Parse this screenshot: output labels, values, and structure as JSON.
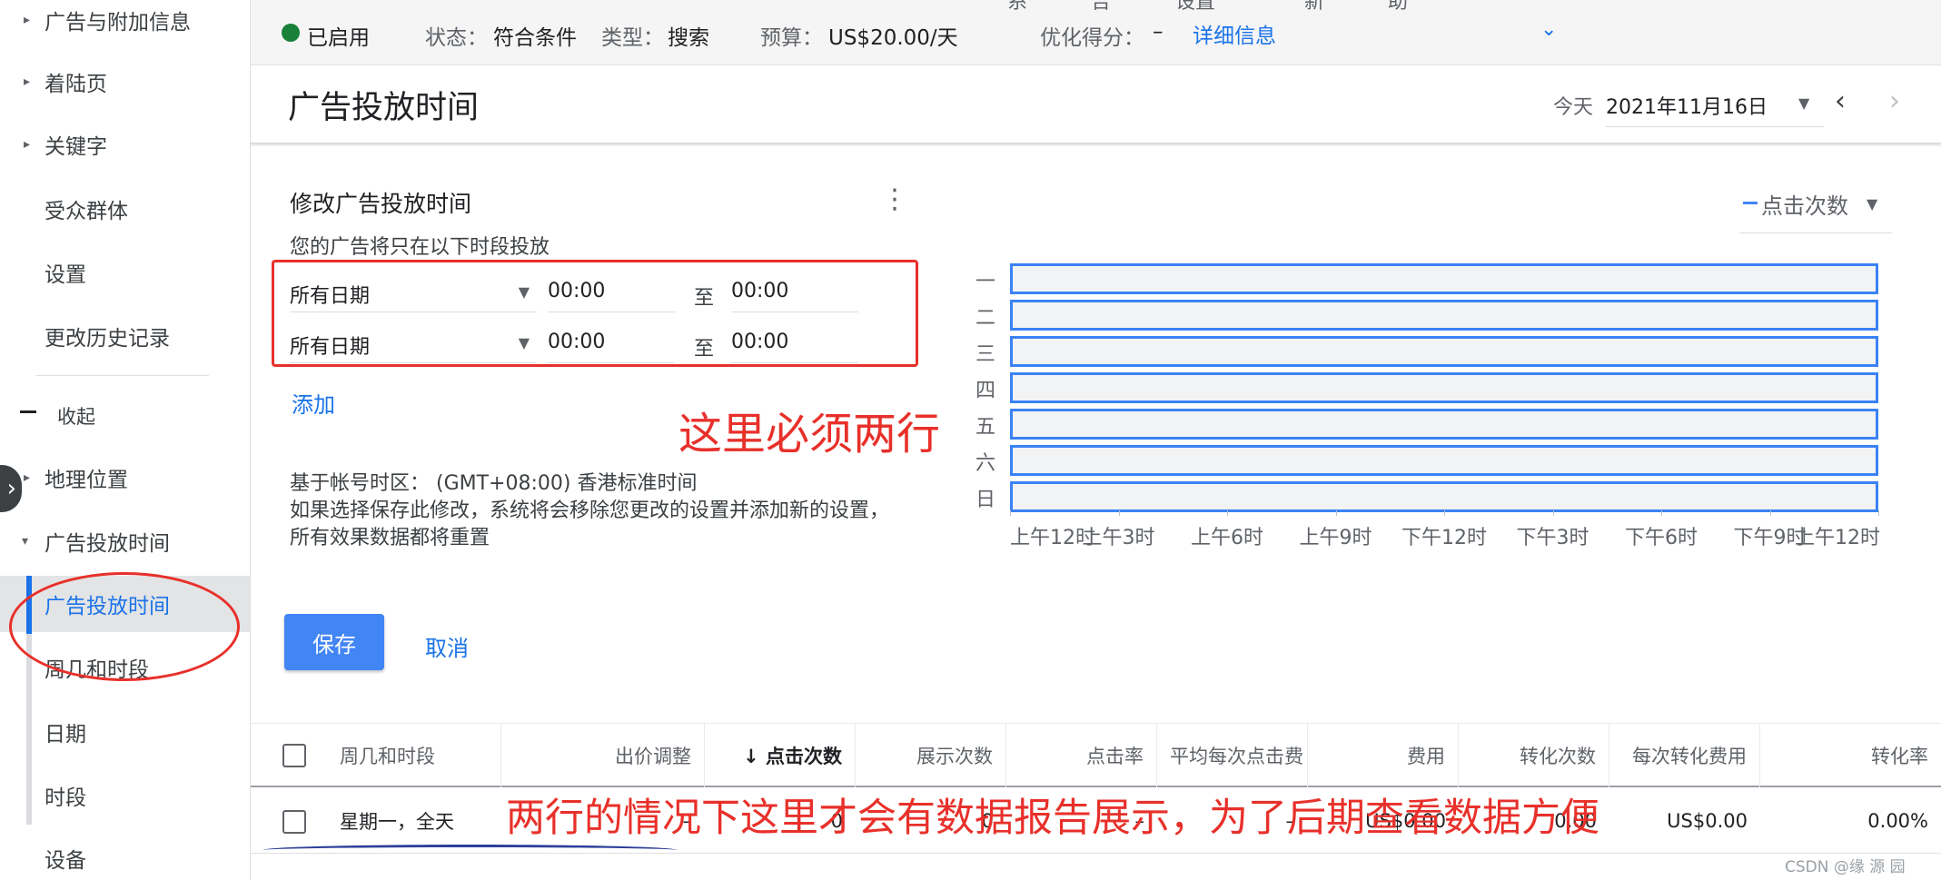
{
  "sidebar": {
    "items": [
      {
        "label": "广告与附加信息",
        "caret": "▸"
      },
      {
        "label": "着陆页",
        "caret": "▸"
      },
      {
        "label": "关键字",
        "caret": "▸"
      },
      {
        "label": "受众群体"
      },
      {
        "label": "设置"
      },
      {
        "label": "更改历史记录"
      }
    ],
    "collapse_label": "收起",
    "expand_glyph": "›",
    "lower_items": [
      {
        "label": "地理位置",
        "caret": "▸"
      },
      {
        "label": "广告投放时间",
        "caret": "▾"
      },
      {
        "label": "广告投放时间",
        "active": true
      },
      {
        "label": "周几和时段"
      },
      {
        "label": "日期"
      },
      {
        "label": "时段"
      },
      {
        "label": "设备"
      }
    ]
  },
  "statusbar": {
    "top_cut": [
      "系",
      "告",
      "设置",
      "新",
      "助"
    ],
    "enabled": "已启用",
    "status_label": "状态：",
    "status_value": "符合条件",
    "type_label": "类型：",
    "type_value": "搜索",
    "budget_label": "预算：",
    "budget_value": "US$20.00/天",
    "opt_label": "优化得分：",
    "opt_value": "–",
    "details_link": "详细信息",
    "details_chevron": "⌄"
  },
  "header": {
    "title": "广告投放时间",
    "today_label": "今天",
    "date": "2021年11月16日",
    "date_caret": "▼",
    "prev": "‹",
    "next": "›"
  },
  "editor": {
    "title": "修改广告投放时间",
    "kebab": "⋮",
    "subtitle": "您的广告将只在以下时段投放",
    "rows": [
      {
        "day": "所有日期",
        "start": "00:00",
        "to": "至",
        "end": "00:00"
      },
      {
        "day": "所有日期",
        "start": "00:00",
        "to": "至",
        "end": "00:00"
      }
    ],
    "dropdown_caret": "▼",
    "add_label": "添加",
    "timezone_text": "基于帐号时区： (GMT+08:00) 香港标准时间",
    "warning_text": "如果选择保存此修改，系统将会移除您更改的设置并添加新的设置，所有效果数据都将重置",
    "save_label": "保存",
    "cancel_label": "取消"
  },
  "annotations": {
    "note_rows": "这里必须两行",
    "note_table": "两行的情况下这里才会有数据报告展示，为了后期查看数据方便"
  },
  "metric_selector": {
    "label": "点击次数",
    "caret": "▼"
  },
  "chart_data": {
    "type": "bar",
    "categories": [
      "一",
      "二",
      "三",
      "四",
      "五",
      "六",
      "日"
    ],
    "x_ticks": [
      "上午12时",
      "上午3时",
      "上午6时",
      "上午9时",
      "下午12时",
      "下午3时",
      "下午6时",
      "下午9时",
      "上午12时"
    ],
    "series_color": "#3b82f6",
    "xlim": [
      0,
      24
    ],
    "bars": [
      {
        "day": "一",
        "start": 0,
        "end": 24
      },
      {
        "day": "二",
        "start": 0,
        "end": 24
      },
      {
        "day": "三",
        "start": 0,
        "end": 24
      },
      {
        "day": "四",
        "start": 0,
        "end": 24
      },
      {
        "day": "五",
        "start": 0,
        "end": 24
      },
      {
        "day": "六",
        "start": 0,
        "end": 24
      },
      {
        "day": "日",
        "start": 0,
        "end": 24
      }
    ]
  },
  "table": {
    "headers": [
      "周几和时段",
      "出价调整",
      "↓ 点击次数",
      "展示次数",
      "点击率",
      "平均每次点击费",
      "费用",
      "转化次数",
      "每次转化费用",
      "转化率"
    ],
    "rows": [
      [
        "星期一，全天",
        "–",
        "0",
        "0",
        "–",
        "–",
        "US$0.00",
        "0.00",
        "US$0.00",
        "0.00%"
      ]
    ]
  },
  "watermark": "CSDN @缘 源 园",
  "colors": {
    "accent": "#1a73e8",
    "annotation": "#e8302a",
    "status_ok": "#188038"
  }
}
